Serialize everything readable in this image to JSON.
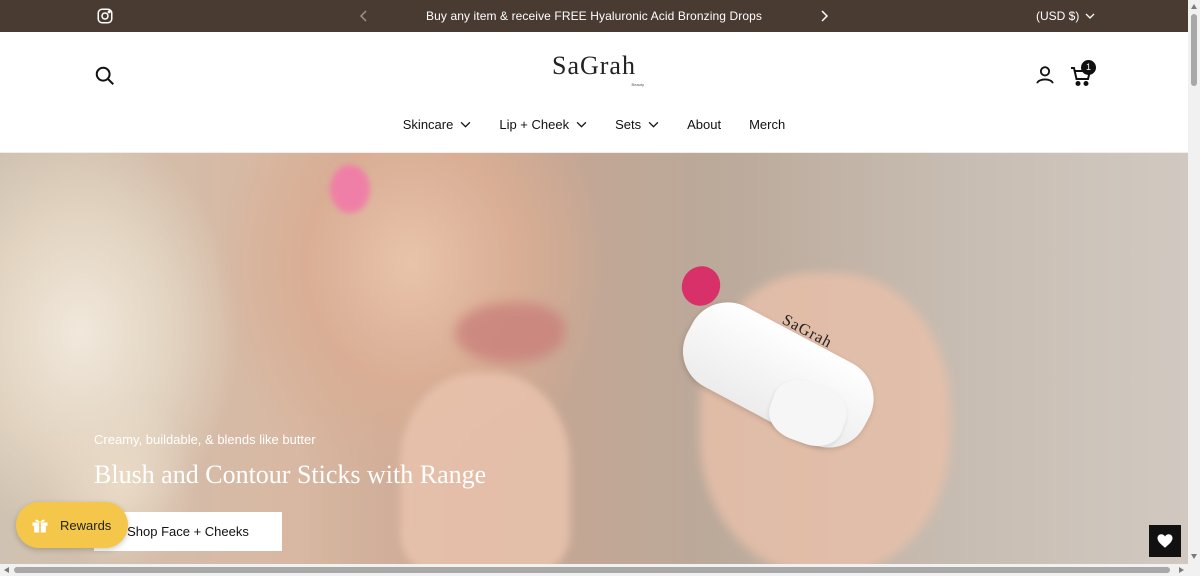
{
  "announcement": {
    "message": "Buy any item & receive FREE Hyaluronic Acid Bronzing Drops",
    "currency": "(USD $)",
    "bg_color": "#4a3b32"
  },
  "header": {
    "logo_text": "SaGrah",
    "logo_subtext": "Beauty",
    "cart_count": "1"
  },
  "nav": {
    "items": [
      {
        "label": "Skincare",
        "has_dropdown": true
      },
      {
        "label": "Lip + Cheek",
        "has_dropdown": true
      },
      {
        "label": "Sets",
        "has_dropdown": true
      },
      {
        "label": "About",
        "has_dropdown": false
      },
      {
        "label": "Merch",
        "has_dropdown": false
      }
    ]
  },
  "hero": {
    "eyebrow": "Creamy, buildable, & blends like butter",
    "headline": "Blush and Contour Sticks with Range",
    "cta_label": "Shop Face + Cheeks",
    "product_label": "SaGrah"
  },
  "rewards": {
    "label": "Rewards",
    "color": "#f4c74a"
  },
  "icons": [
    "instagram-icon",
    "chevron-left-icon",
    "chevron-right-icon",
    "chevron-down-icon",
    "search-icon",
    "account-icon",
    "cart-icon",
    "gift-icon",
    "heart-icon"
  ]
}
